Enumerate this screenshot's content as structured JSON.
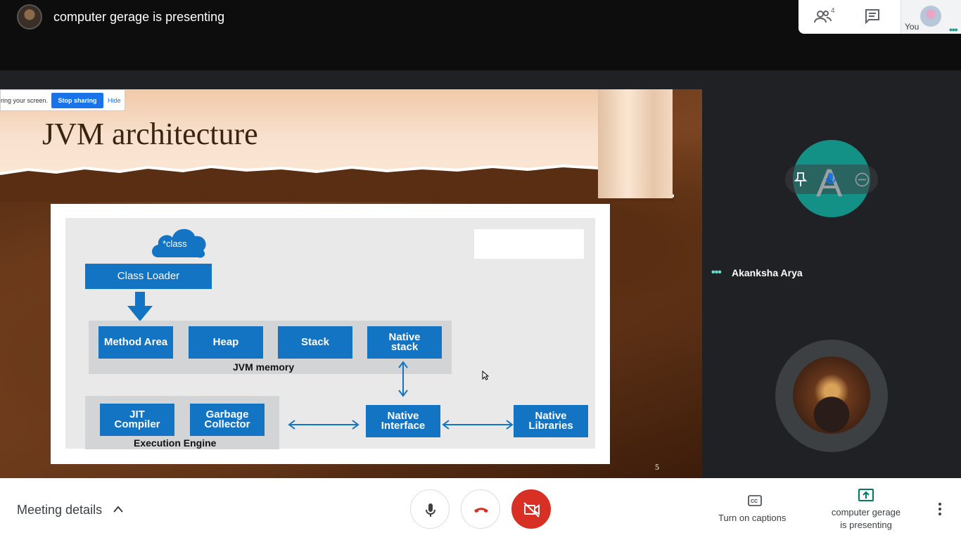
{
  "header": {
    "presenter_title": "computer gerage is presenting",
    "people_count": "4",
    "self_label": "You"
  },
  "share_banner": {
    "text": "ring your screen.",
    "stop_label": "Stop sharing",
    "hide_label": "Hide"
  },
  "slide": {
    "title": "JVM architecture",
    "page_number": "5",
    "diagram": {
      "cloud_label": "*class",
      "class_loader": "Class Loader",
      "memory_boxes": [
        "Method Area",
        "Heap",
        "Stack",
        "Native stack"
      ],
      "memory_label": "JVM memory",
      "engine_boxes": [
        "JIT Compiler",
        "Garbage Collector"
      ],
      "engine_label": "Execution Engine",
      "native_interface": "Native Interface",
      "native_libraries": "Native Libraries"
    }
  },
  "participants": [
    {
      "name": "Akanksha Arya",
      "initial": "A",
      "tile_color": "#149186"
    },
    {
      "name": "",
      "initial": ""
    }
  ],
  "bottom": {
    "meeting_details": "Meeting details",
    "captions": "Turn on captions",
    "presenting_line1": "computer gerage",
    "presenting_line2": "is presenting"
  },
  "colors": {
    "end_call": "#d93025",
    "camera_off": "#d93025",
    "accent_blue": "#1a73e8",
    "teal": "#149186"
  }
}
